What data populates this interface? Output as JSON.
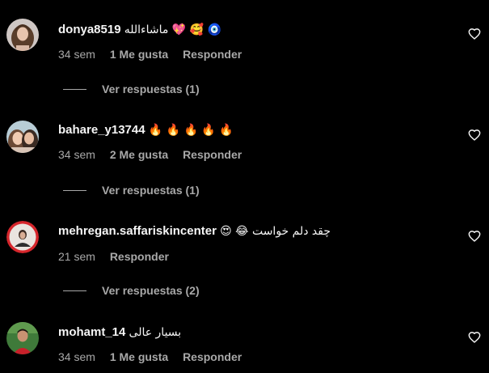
{
  "comments": [
    {
      "username": "donya8519",
      "text": "ماشاءالله 💖 🥰 🧿",
      "time": "34 sem",
      "likes": "1 Me gusta",
      "reply": "Responder",
      "replies": "Ver respuestas (1)",
      "avatar_icon": "avatar-photo-woman-long-hair"
    },
    {
      "username": "bahare_y13744",
      "text": "🔥 🔥 🔥 🔥 🔥",
      "time": "34 sem",
      "likes": "2 Me gusta",
      "reply": "Responder",
      "replies": "Ver respuestas (1)",
      "avatar_icon": "avatar-photo-two-women"
    },
    {
      "username": "mehregan.saffariskincenter",
      "text": "😍 😂 چقد دلم خواست",
      "time": "21 sem",
      "likes": "",
      "reply": "Responder",
      "replies": "Ver respuestas (2)",
      "avatar_icon": "avatar-logo-red-ring"
    },
    {
      "username": "mohamt_14",
      "text": "بسیار عالی",
      "time": "34 sem",
      "likes": "1 Me gusta",
      "reply": "Responder",
      "replies": "",
      "avatar_icon": "avatar-photo-boy-green"
    }
  ],
  "icons": {
    "like": "heart-outline-icon"
  },
  "colors": {
    "background": "#000000",
    "text_primary": "#f5f5f5",
    "text_secondary": "#a8a8a8",
    "avatar_ring": "#d6262c"
  }
}
